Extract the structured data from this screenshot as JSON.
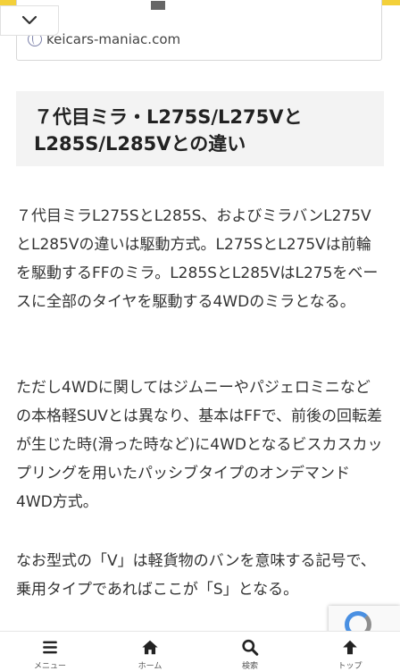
{
  "link_card": {
    "url": "keicars-maniac.com"
  },
  "article": {
    "heading": "７代目ミラ・L275S/L275VとL285S/L285Vとの違い",
    "paragraphs": [
      "７代目ミラL275SとL285S、およびミラバンL275VとL285Vの違いは駆動方式。L275SとL275Vは前輪を駆動するFFのミラ。L285SとL285VはL275をベースに全部のタイヤを駆動する4WDのミラとなる。",
      "ただし4WDに関してはジムニーやパジェロミニなどの本格軽SUVとは異なり、基本はFFで、前後の回転差が生じた時(滑った時など)に4WDとなるビスカスカップリングを用いたパッシブタイプのオンデマンド4WD方式。",
      "なお型式の「V」は軽貨物のバンを意味する記号で、乗用タイプであればここが「S」となる。"
    ]
  },
  "bottom_nav": {
    "items": [
      {
        "label": "メニュー",
        "icon": "menu-icon"
      },
      {
        "label": "ホーム",
        "icon": "home-icon"
      },
      {
        "label": "検索",
        "icon": "search-icon"
      },
      {
        "label": "トップ",
        "icon": "arrow-up-icon"
      }
    ]
  },
  "colors": {
    "accent": "#f3d03a",
    "heading_bg": "#f3f3f3",
    "text": "#333333"
  }
}
